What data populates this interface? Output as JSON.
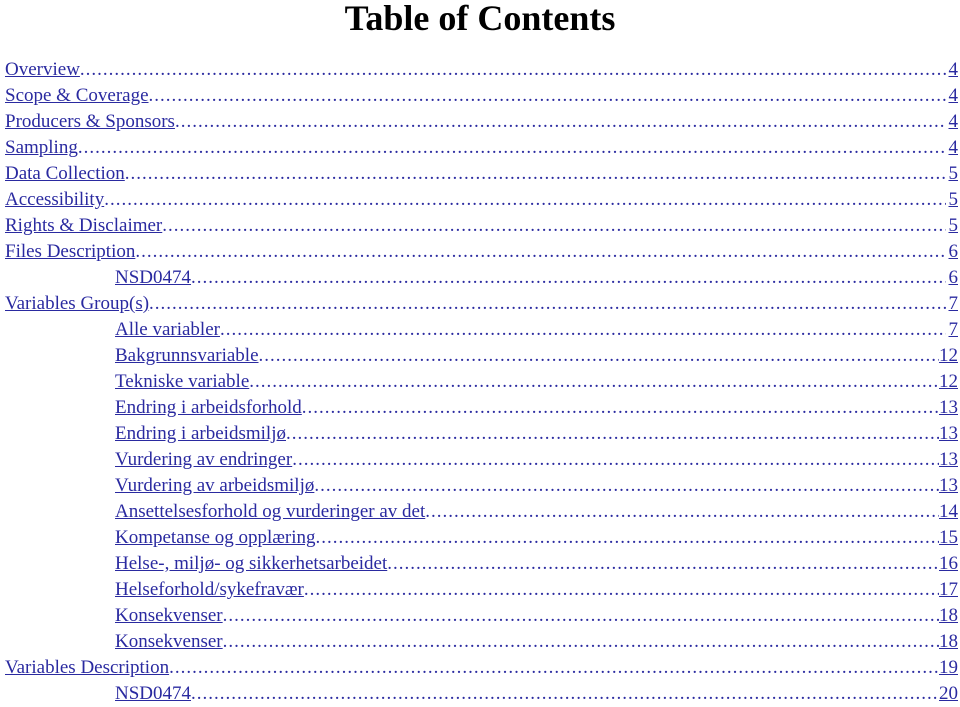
{
  "title": "Table of Contents",
  "link_color": "#2a2aa0",
  "entries": [
    {
      "label": "Overview",
      "page": "4",
      "level": 0
    },
    {
      "label": "Scope & Coverage",
      "page": "4",
      "level": 0
    },
    {
      "label": "Producers & Sponsors",
      "page": "4",
      "level": 0
    },
    {
      "label": "Sampling",
      "page": "4",
      "level": 0
    },
    {
      "label": "Data Collection",
      "page": "5",
      "level": 0
    },
    {
      "label": "Accessibility",
      "page": "5",
      "level": 0
    },
    {
      "label": "Rights & Disclaimer",
      "page": "5",
      "level": 0
    },
    {
      "label": "Files Description",
      "page": "6",
      "level": 0
    },
    {
      "label": "NSD0474",
      "page": "6",
      "level": 1
    },
    {
      "label": "Variables Group(s)",
      "page": "7",
      "level": 0
    },
    {
      "label": "Alle variabler",
      "page": "7",
      "level": 1
    },
    {
      "label": "Bakgrunnsvariable",
      "page": "12",
      "level": 1
    },
    {
      "label": "Tekniske variable",
      "page": "12",
      "level": 1
    },
    {
      "label": "Endring i arbeidsforhold",
      "page": "13",
      "level": 1
    },
    {
      "label": "Endring i arbeidsmiljø",
      "page": "13",
      "level": 1
    },
    {
      "label": "Vurdering av endringer",
      "page": "13",
      "level": 1
    },
    {
      "label": "Vurdering av arbeidsmiljø",
      "page": "13",
      "level": 1
    },
    {
      "label": "Ansettelsesforhold og vurderinger av det",
      "page": "14",
      "level": 1
    },
    {
      "label": "Kompetanse og opplæring",
      "page": "15",
      "level": 1
    },
    {
      "label": "Helse-, miljø- og sikkerhetsarbeidet",
      "page": "16",
      "level": 1
    },
    {
      "label": "Helseforhold/sykefravær",
      "page": "17",
      "level": 1
    },
    {
      "label": "Konsekvenser",
      "page": "18",
      "level": 1
    },
    {
      "label": "Konsekvenser",
      "page": "18",
      "level": 1
    },
    {
      "label": "Variables Description",
      "page": "19",
      "level": 0
    },
    {
      "label": "NSD0474",
      "page": "20",
      "level": 1
    }
  ]
}
